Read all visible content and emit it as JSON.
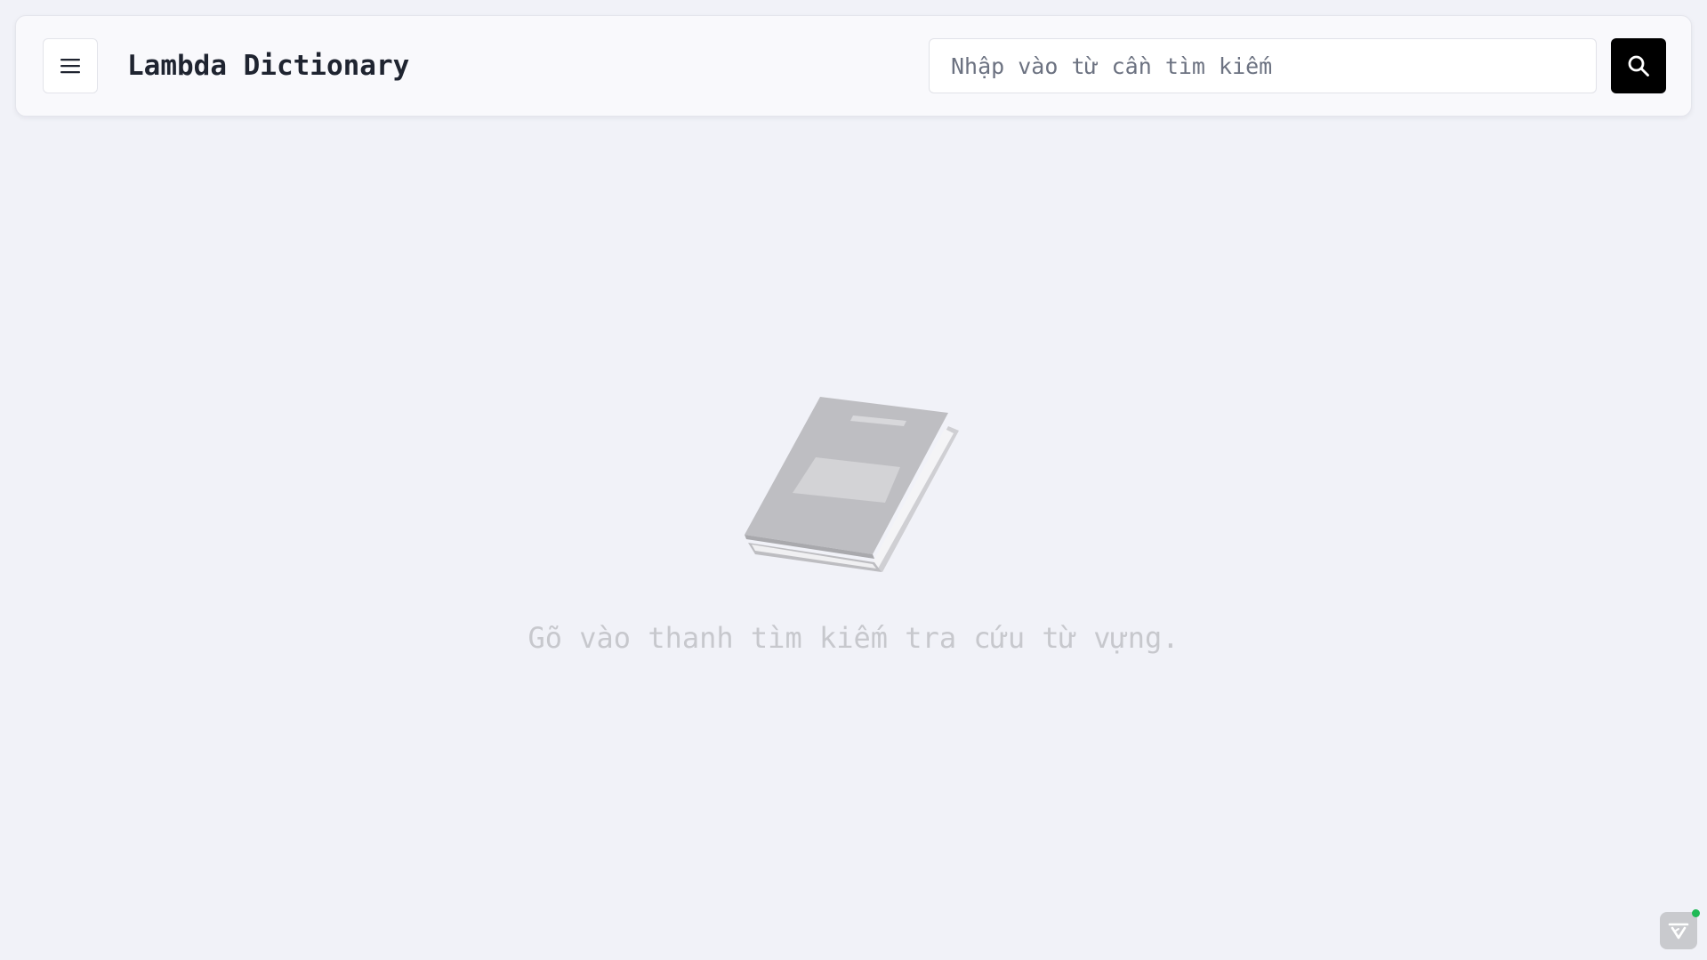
{
  "header": {
    "menu_icon": "hamburger-menu-icon",
    "title": "Lambda Dictionary",
    "search": {
      "placeholder": "Nhập vào từ cần tìm kiếm",
      "value": ""
    },
    "search_button_icon": "search-icon"
  },
  "main": {
    "illustration": "book-icon",
    "empty_message": "Gõ vào thanh tìm kiếm tra cứu từ vựng."
  },
  "corner_widget": {
    "icon": "devtools-logo-icon",
    "status_color": "#1fb955"
  },
  "colors": {
    "background": "#f1f2f8",
    "header_background": "#f9f9fc",
    "title_text": "#1f2430",
    "search_button": "#000000",
    "empty_message_text": "#c7c8cd",
    "illustration": "#bebec2"
  }
}
